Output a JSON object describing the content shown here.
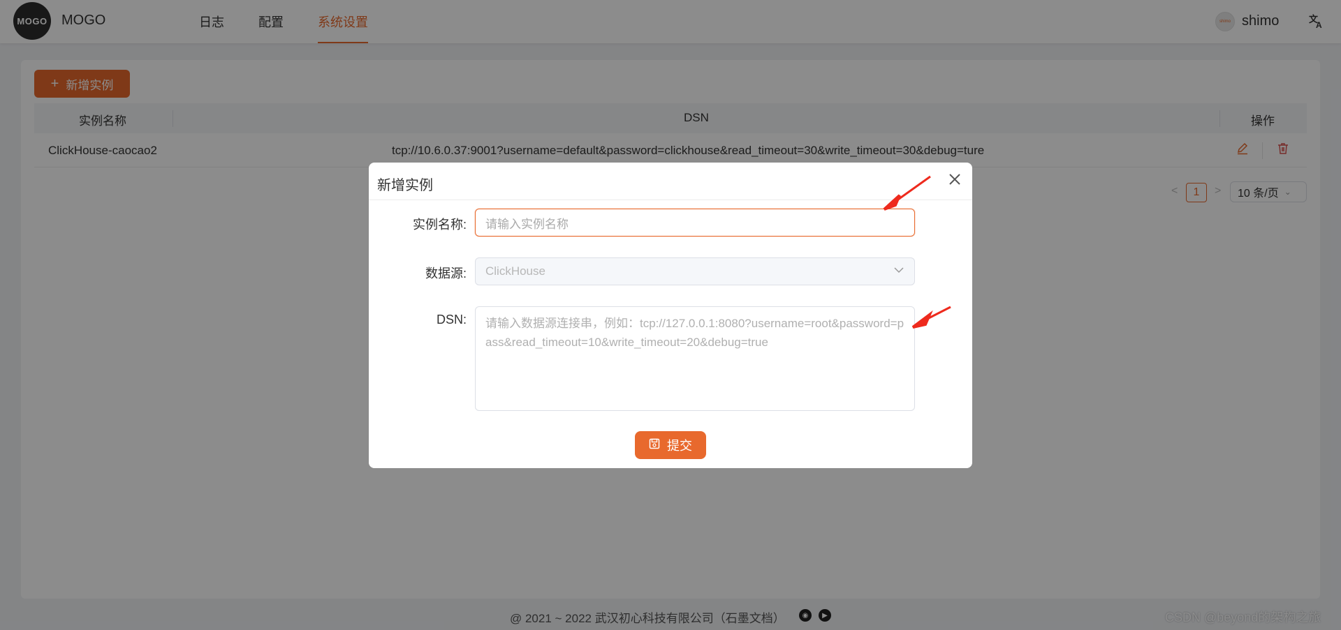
{
  "header": {
    "logo_text": "MOGO",
    "brand": "MOGO",
    "nav": [
      {
        "label": "日志"
      },
      {
        "label": "配置"
      },
      {
        "label": "系统设置"
      }
    ],
    "user": {
      "avatar_text": "shimo",
      "name": "shimo"
    },
    "accent_color": "#e8692d"
  },
  "main": {
    "add_button": {
      "icon": "plus-icon",
      "label": "新增实例"
    },
    "table": {
      "columns": [
        "实例名称",
        "DSN",
        "操作"
      ],
      "rows": [
        {
          "name": "ClickHouse-caocao2",
          "dsn": "tcp://10.6.0.37:9001?username=default&password=clickhouse&read_timeout=30&write_timeout=30&debug=ture",
          "actions": [
            "edit-icon",
            "delete-icon"
          ]
        }
      ]
    },
    "pagination": {
      "current_page": "1",
      "page_size": "10 条/页"
    }
  },
  "footer": {
    "text": "@ 2021 ~ 2022 武汉初心科技有限公司（石墨文档）",
    "icons": [
      "github-icon",
      "app-icon"
    ],
    "watermark": "CSDN @beyond的架构之旅"
  },
  "modal": {
    "title": "新增实例",
    "fields": {
      "name": {
        "label": "实例名称:",
        "placeholder": "请输入实例名称"
      },
      "datasource": {
        "label": "数据源:",
        "value": "ClickHouse"
      },
      "dsn": {
        "label": "DSN:",
        "placeholder": "请输入数据源连接串，例如：tcp://127.0.0.1:8080?username=root&password=pass&read_timeout=10&write_timeout=20&debug=true"
      }
    },
    "submit": {
      "icon": "save-icon",
      "label": "提交"
    }
  }
}
